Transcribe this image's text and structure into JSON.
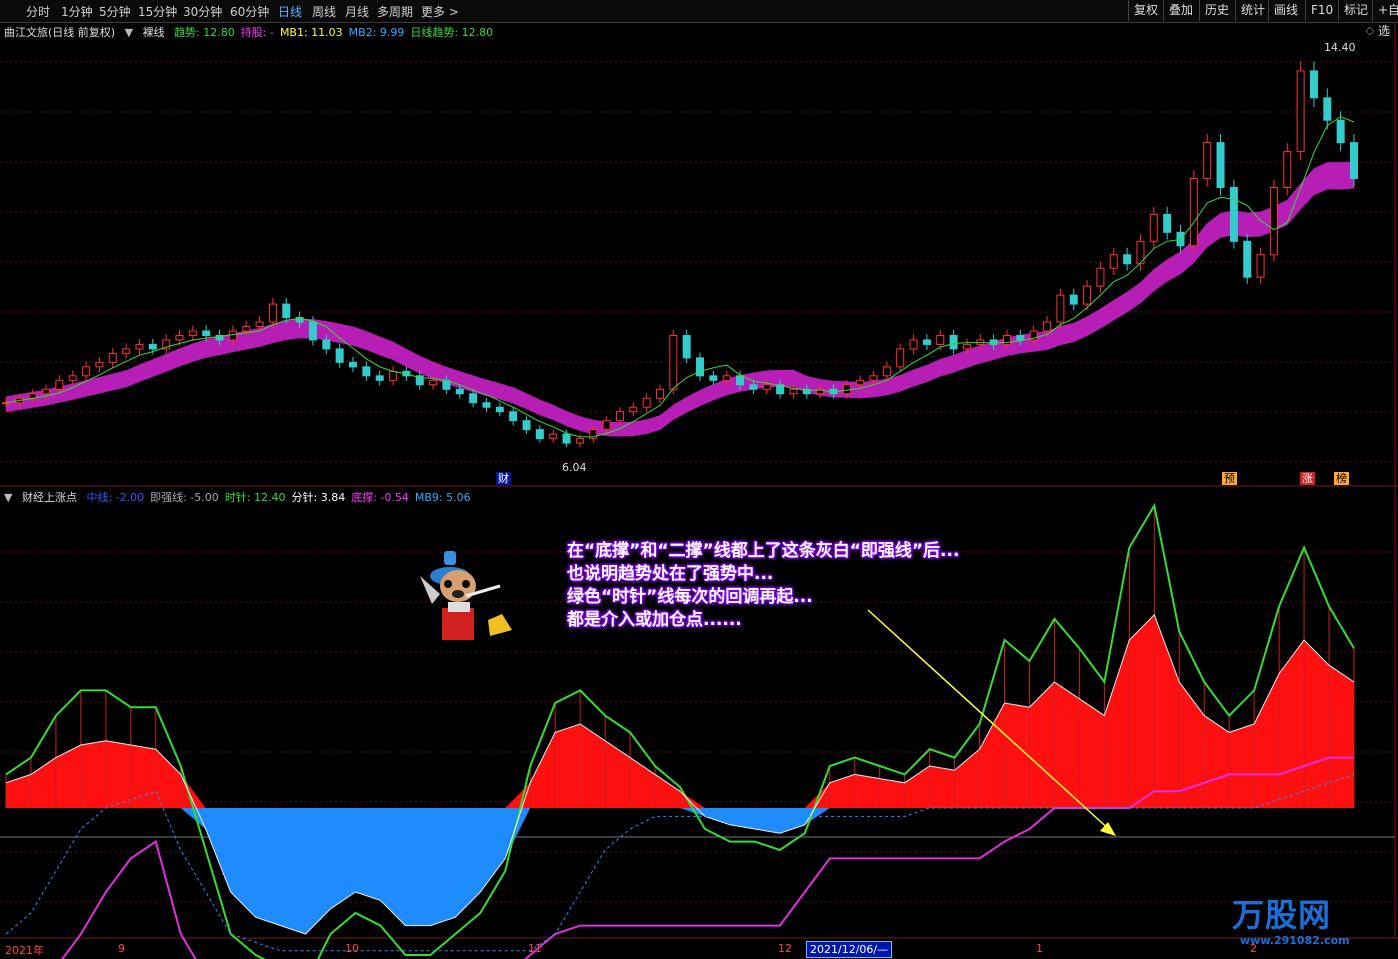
{
  "toolbar": {
    "periods": [
      "分时",
      "1分钟",
      "5分钟",
      "15分钟",
      "30分钟",
      "60分钟",
      "日线",
      "周线",
      "月线",
      "多周期",
      "更多 >"
    ],
    "active_period": "日线",
    "right_buttons": [
      "复权",
      "叠加",
      "历史",
      "统计",
      "画线",
      "F10",
      "标记",
      "+自选"
    ]
  },
  "main_panel": {
    "stock_name": "曲江文旅(日线 前复权)",
    "indicator_name": "裸线",
    "legend": [
      {
        "label": "趋势:",
        "value": "12.80",
        "color": "#33dd33"
      },
      {
        "label": "持股:",
        "value": "-",
        "color": "#ff33ff"
      },
      {
        "label": "MB1:",
        "value": "11.03",
        "color": "#ffff33"
      },
      {
        "label": "MB2:",
        "value": "9.99",
        "color": "#33aaff"
      },
      {
        "label": "日线趋势:",
        "value": "12.80",
        "color": "#33dd33"
      }
    ],
    "high_label": "14.40",
    "low_label": "6.04",
    "marker_cai": "财",
    "marker_yu": "预",
    "marker_zhang": "涨",
    "marker_bang": "榜"
  },
  "sub_panel": {
    "indicator_name": "财经上涨点",
    "legend": [
      {
        "label": "中线:",
        "value": "-2.00",
        "color": "#3355ff"
      },
      {
        "label": "即强线:",
        "value": "-5.00",
        "color": "#aaaaaa"
      },
      {
        "label": "时针:",
        "value": "12.40",
        "color": "#33dd33"
      },
      {
        "label": "分针:",
        "value": "3.84",
        "color": "#ffffff"
      },
      {
        "label": "底撑:",
        "value": "-0.54",
        "color": "#ff33ff"
      },
      {
        "label": "MB9:",
        "value": "5.06",
        "color": "#33aaff"
      }
    ]
  },
  "annotation": {
    "lines": [
      "在“底撑”和“二撑”线都上了这条灰白“即强线”后...",
      "也说明趋势处在了强势中...",
      "绿色“时针”线每次的回调再起...",
      "都是介入或加仓点......"
    ]
  },
  "x_axis": {
    "labels": [
      "2021年",
      "9",
      "10",
      "11",
      "12",
      "1",
      "2"
    ],
    "date_box": "2021/12/06/—"
  },
  "watermark": {
    "brand": "万股网",
    "url": "www.291082.com"
  },
  "chart_data": [
    {
      "type": "candlestick",
      "title": "曲江文旅(日线 前复权)",
      "x_labels": [
        "2021年",
        "9",
        "10",
        "11",
        "12",
        "1",
        "2"
      ],
      "y_range": [
        5.5,
        15.0
      ],
      "high": 14.4,
      "low": 6.04,
      "close_series": [
        7.0,
        7.1,
        7.2,
        7.3,
        7.5,
        7.6,
        7.8,
        7.9,
        8.1,
        8.2,
        8.3,
        8.2,
        8.4,
        8.5,
        8.6,
        8.5,
        8.4,
        8.6,
        8.7,
        8.8,
        9.2,
        8.9,
        8.8,
        8.4,
        8.2,
        7.9,
        7.8,
        7.6,
        7.5,
        7.7,
        7.6,
        7.4,
        7.5,
        7.3,
        7.2,
        7.0,
        6.9,
        6.8,
        6.6,
        6.4,
        6.2,
        6.3,
        6.1,
        6.2,
        6.4,
        6.6,
        6.8,
        6.9,
        7.1,
        7.3,
        8.5,
        8.0,
        7.6,
        7.5,
        7.6,
        7.4,
        7.3,
        7.4,
        7.2,
        7.3,
        7.2,
        7.3,
        7.2,
        7.4,
        7.5,
        7.6,
        7.8,
        8.2,
        8.4,
        8.3,
        8.5,
        8.2,
        8.3,
        8.4,
        8.3,
        8.5,
        8.4,
        8.6,
        8.8,
        9.4,
        9.2,
        9.6,
        10.0,
        10.3,
        10.1,
        10.6,
        11.2,
        10.8,
        10.5,
        12.0,
        12.8,
        11.8,
        10.6,
        9.8,
        10.3,
        11.8,
        12.6,
        14.4,
        13.8,
        13.3,
        12.8,
        12.0
      ]
    },
    {
      "type": "line",
      "title": "财经上涨点",
      "series": [
        {
          "name": "时针",
          "values": [
            8,
            12,
            22,
            28,
            28,
            24,
            24,
            10,
            -10,
            -30,
            -35,
            -38,
            -42,
            -30,
            -25,
            -28,
            -35,
            -35,
            -30,
            -25,
            -15,
            10,
            25,
            28,
            22,
            18,
            10,
            5,
            -5,
            -8,
            -8,
            -10,
            -6,
            10,
            12,
            10,
            8,
            14,
            12,
            20,
            40,
            35,
            45,
            38,
            30,
            62,
            72,
            42,
            30,
            22,
            28,
            48,
            62,
            48,
            38
          ]
        },
        {
          "name": "分针",
          "values": [
            6,
            8,
            12,
            15,
            16,
            15,
            14,
            8,
            -5,
            -20,
            -26,
            -28,
            -30,
            -24,
            -20,
            -22,
            -28,
            -28,
            -26,
            -20,
            -12,
            6,
            18,
            20,
            16,
            12,
            8,
            4,
            -2,
            -4,
            -5,
            -6,
            -4,
            6,
            8,
            7,
            6,
            10,
            9,
            14,
            25,
            24,
            30,
            26,
            22,
            40,
            46,
            30,
            22,
            18,
            20,
            32,
            40,
            34,
            30
          ]
        },
        {
          "name": "底撑",
          "values": [
            -40,
            -40,
            -38,
            -30,
            -20,
            -12,
            -8,
            -30,
            -40,
            -42,
            -45,
            -45,
            -45,
            -45,
            -44,
            -44,
            -44,
            -44,
            -43,
            -42,
            -40,
            -35,
            -30,
            -28,
            -28,
            -28,
            -28,
            -28,
            -28,
            -28,
            -28,
            -28,
            -20,
            -12,
            -12,
            -12,
            -12,
            -12,
            -12,
            -12,
            -8,
            -5,
            0,
            0,
            0,
            0,
            4,
            4,
            6,
            8,
            8,
            8,
            10,
            12,
            12
          ]
        },
        {
          "name": "MB9",
          "values": [
            -30,
            -25,
            -15,
            -5,
            0,
            2,
            4,
            -10,
            -20,
            -30,
            -32,
            -34,
            -34,
            -34,
            -34,
            -34,
            -34,
            -34,
            -34,
            -34,
            -34,
            -34,
            -30,
            -20,
            -10,
            -5,
            -2,
            -2,
            -2,
            -2,
            -2,
            -2,
            -2,
            -2,
            -2,
            -2,
            -2,
            0,
            0,
            0,
            0,
            0,
            0,
            0,
            0,
            0,
            0,
            0,
            0,
            0,
            0,
            2,
            4,
            6,
            8
          ]
        }
      ]
    }
  ]
}
